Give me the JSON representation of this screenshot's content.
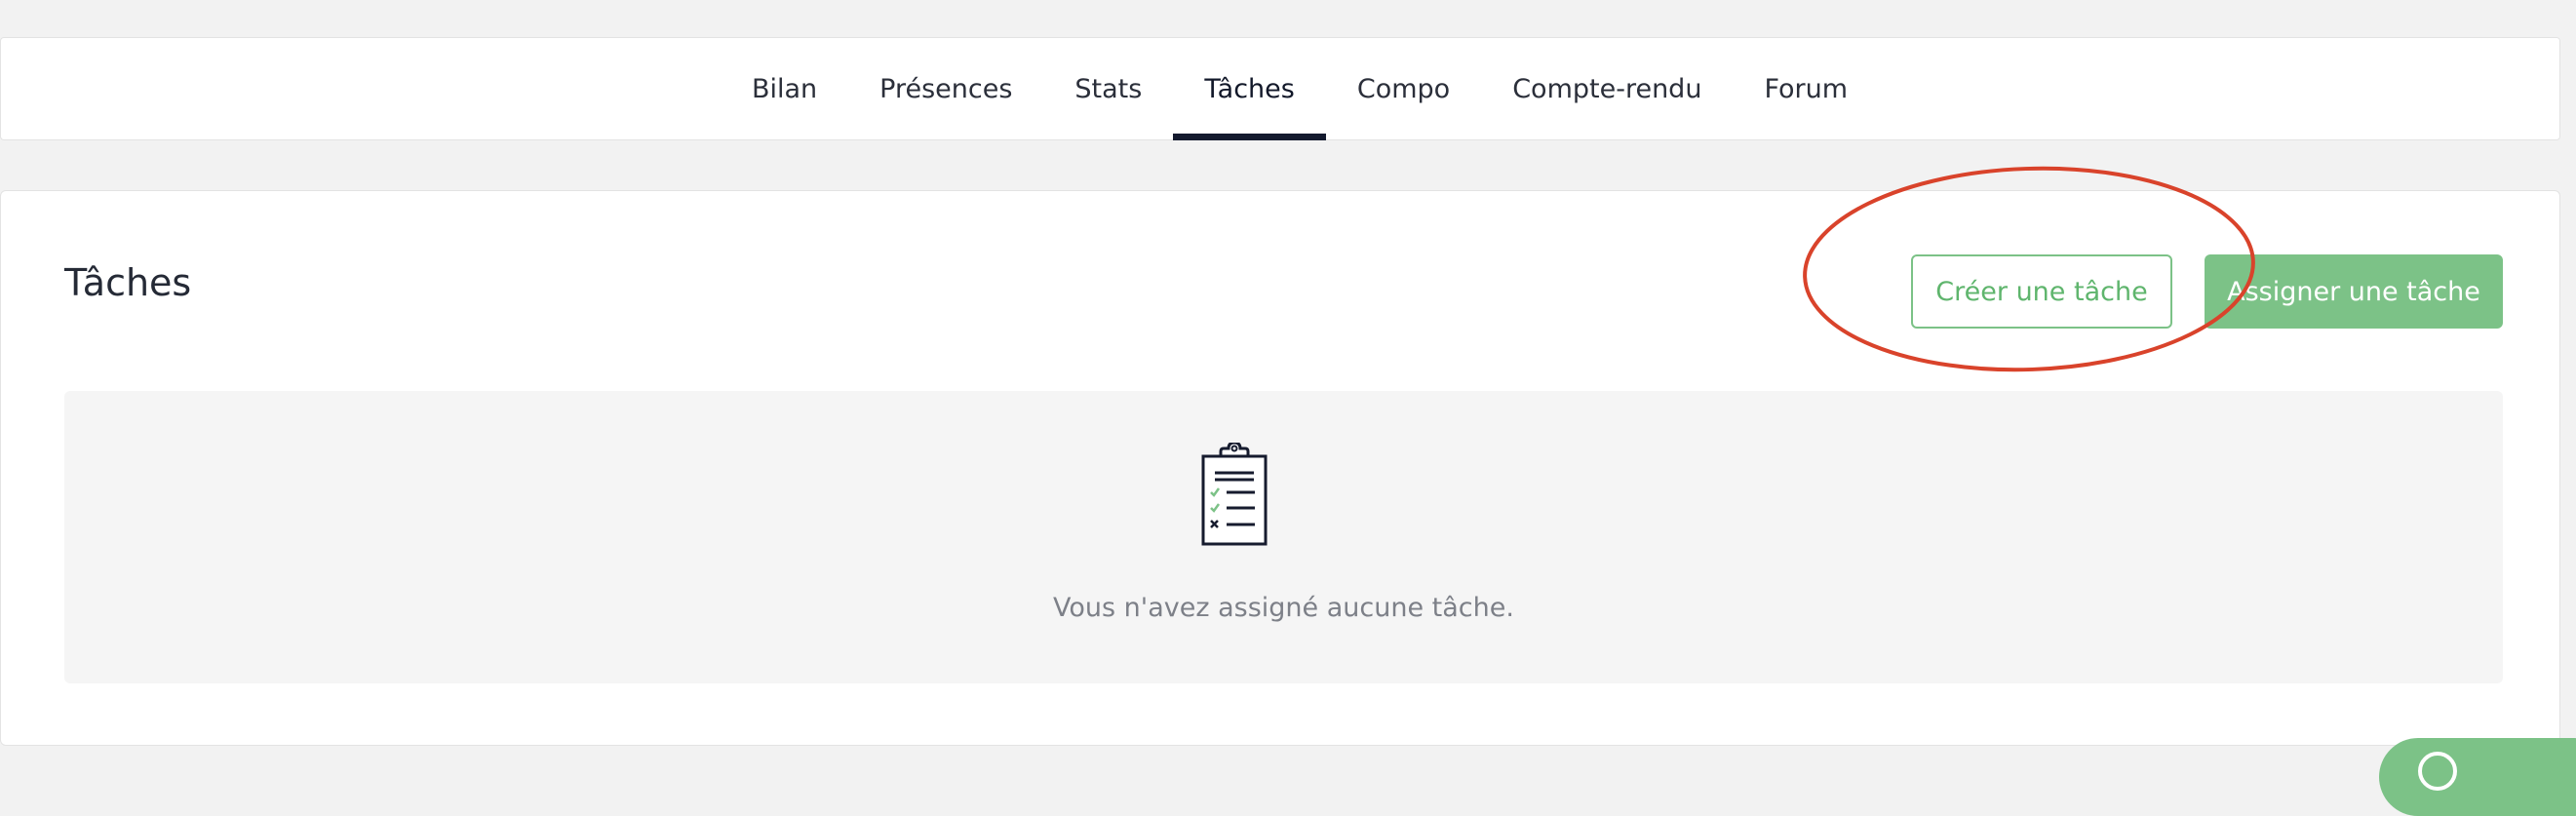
{
  "nav": {
    "tabs": [
      {
        "label": "Bilan",
        "active": false
      },
      {
        "label": "Présences",
        "active": false
      },
      {
        "label": "Stats",
        "active": false
      },
      {
        "label": "Tâches",
        "active": true
      },
      {
        "label": "Compo",
        "active": false
      },
      {
        "label": "Compte-rendu",
        "active": false
      },
      {
        "label": "Forum",
        "active": false
      }
    ]
  },
  "card": {
    "title": "Tâches",
    "create_button_label": "Créer une tâche",
    "assign_button_label": "Assigner une tâche",
    "empty_state": {
      "icon": "clipboard-checklist-icon",
      "message": "Vous n'avez assigné aucune tâche."
    }
  },
  "annotation": {
    "shape": "ellipse",
    "color": "#d9432b",
    "target": "create-task-button"
  },
  "chat_widget": {
    "icon": "chat-icon"
  },
  "colors": {
    "accent_green": "#7cc287",
    "nav_active_underline": "#141a2e",
    "background": "#f2f2f2"
  }
}
